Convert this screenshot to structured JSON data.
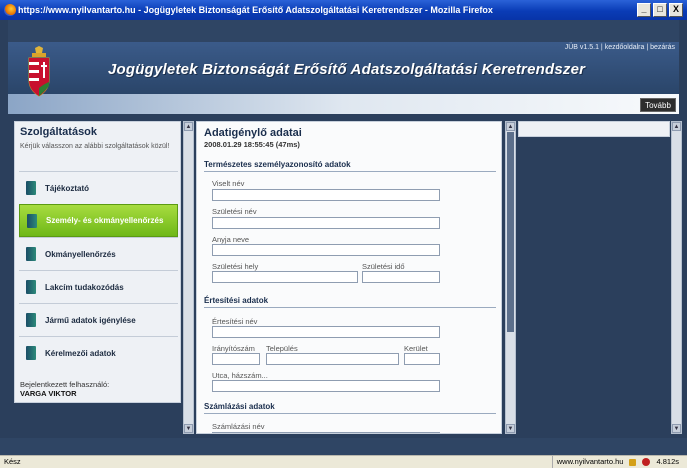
{
  "window": {
    "title": "https://www.nyilvantarto.hu - Jogügyletek Biztonságát Erősítő Adatszolgáltatási Keretrendszer - Mozilla Firefox",
    "min": "_",
    "max": "□",
    "close": "X"
  },
  "header": {
    "title": "Jogügyletek Biztonságát Erősítő Adatszolgáltatási Keretrendszer",
    "links": "JÜB v1.5.1 | kezdőoldalra | bezárás",
    "next_button": "Tovább"
  },
  "left": {
    "title": "Szolgáltatások",
    "description": "Kérjük válasszon az alábbi szolgáltatások közül!",
    "items": [
      {
        "label": "Tájékoztató",
        "active": false
      },
      {
        "label": "Személy- és okmányellenőrzés",
        "active": true
      },
      {
        "label": "Okmányellenőrzés",
        "active": false
      },
      {
        "label": "Lakcím tudakozódás",
        "active": false
      },
      {
        "label": "Jármű adatok igénylése",
        "active": false
      },
      {
        "label": "Kérelmezői adatok",
        "active": false
      }
    ],
    "logged_in_label": "Bejelentkezett felhasználó:",
    "logged_in_user": "VARGA VIKTOR"
  },
  "form": {
    "title": "Adatigénylő adatai",
    "datetime": "2008.01.29 18:55:45 (47ms)",
    "sections": {
      "personal": "Természetes személyazonosító adatok",
      "notify": "Értesítési adatok",
      "billing": "Számlázási adatok"
    },
    "fields": {
      "viselt_nev": "Viselt név",
      "szuletesi_nev": "Születési név",
      "anyja_neve": "Anyja neve",
      "szuletesi_hely": "Születési hely",
      "szuletesi_ido": "Születési idő",
      "ertesitesi_nev": "Értesítési név",
      "iranyitoszam": "Irányítószám",
      "telepules": "Település",
      "kerulet": "Kerület",
      "utca": "Utca, házszám...",
      "szamlazasi_nev": "Számlázási név"
    }
  },
  "status": {
    "left": "Kész",
    "domain": "www.nyilvantarto.hu",
    "timing": "4.812s"
  }
}
